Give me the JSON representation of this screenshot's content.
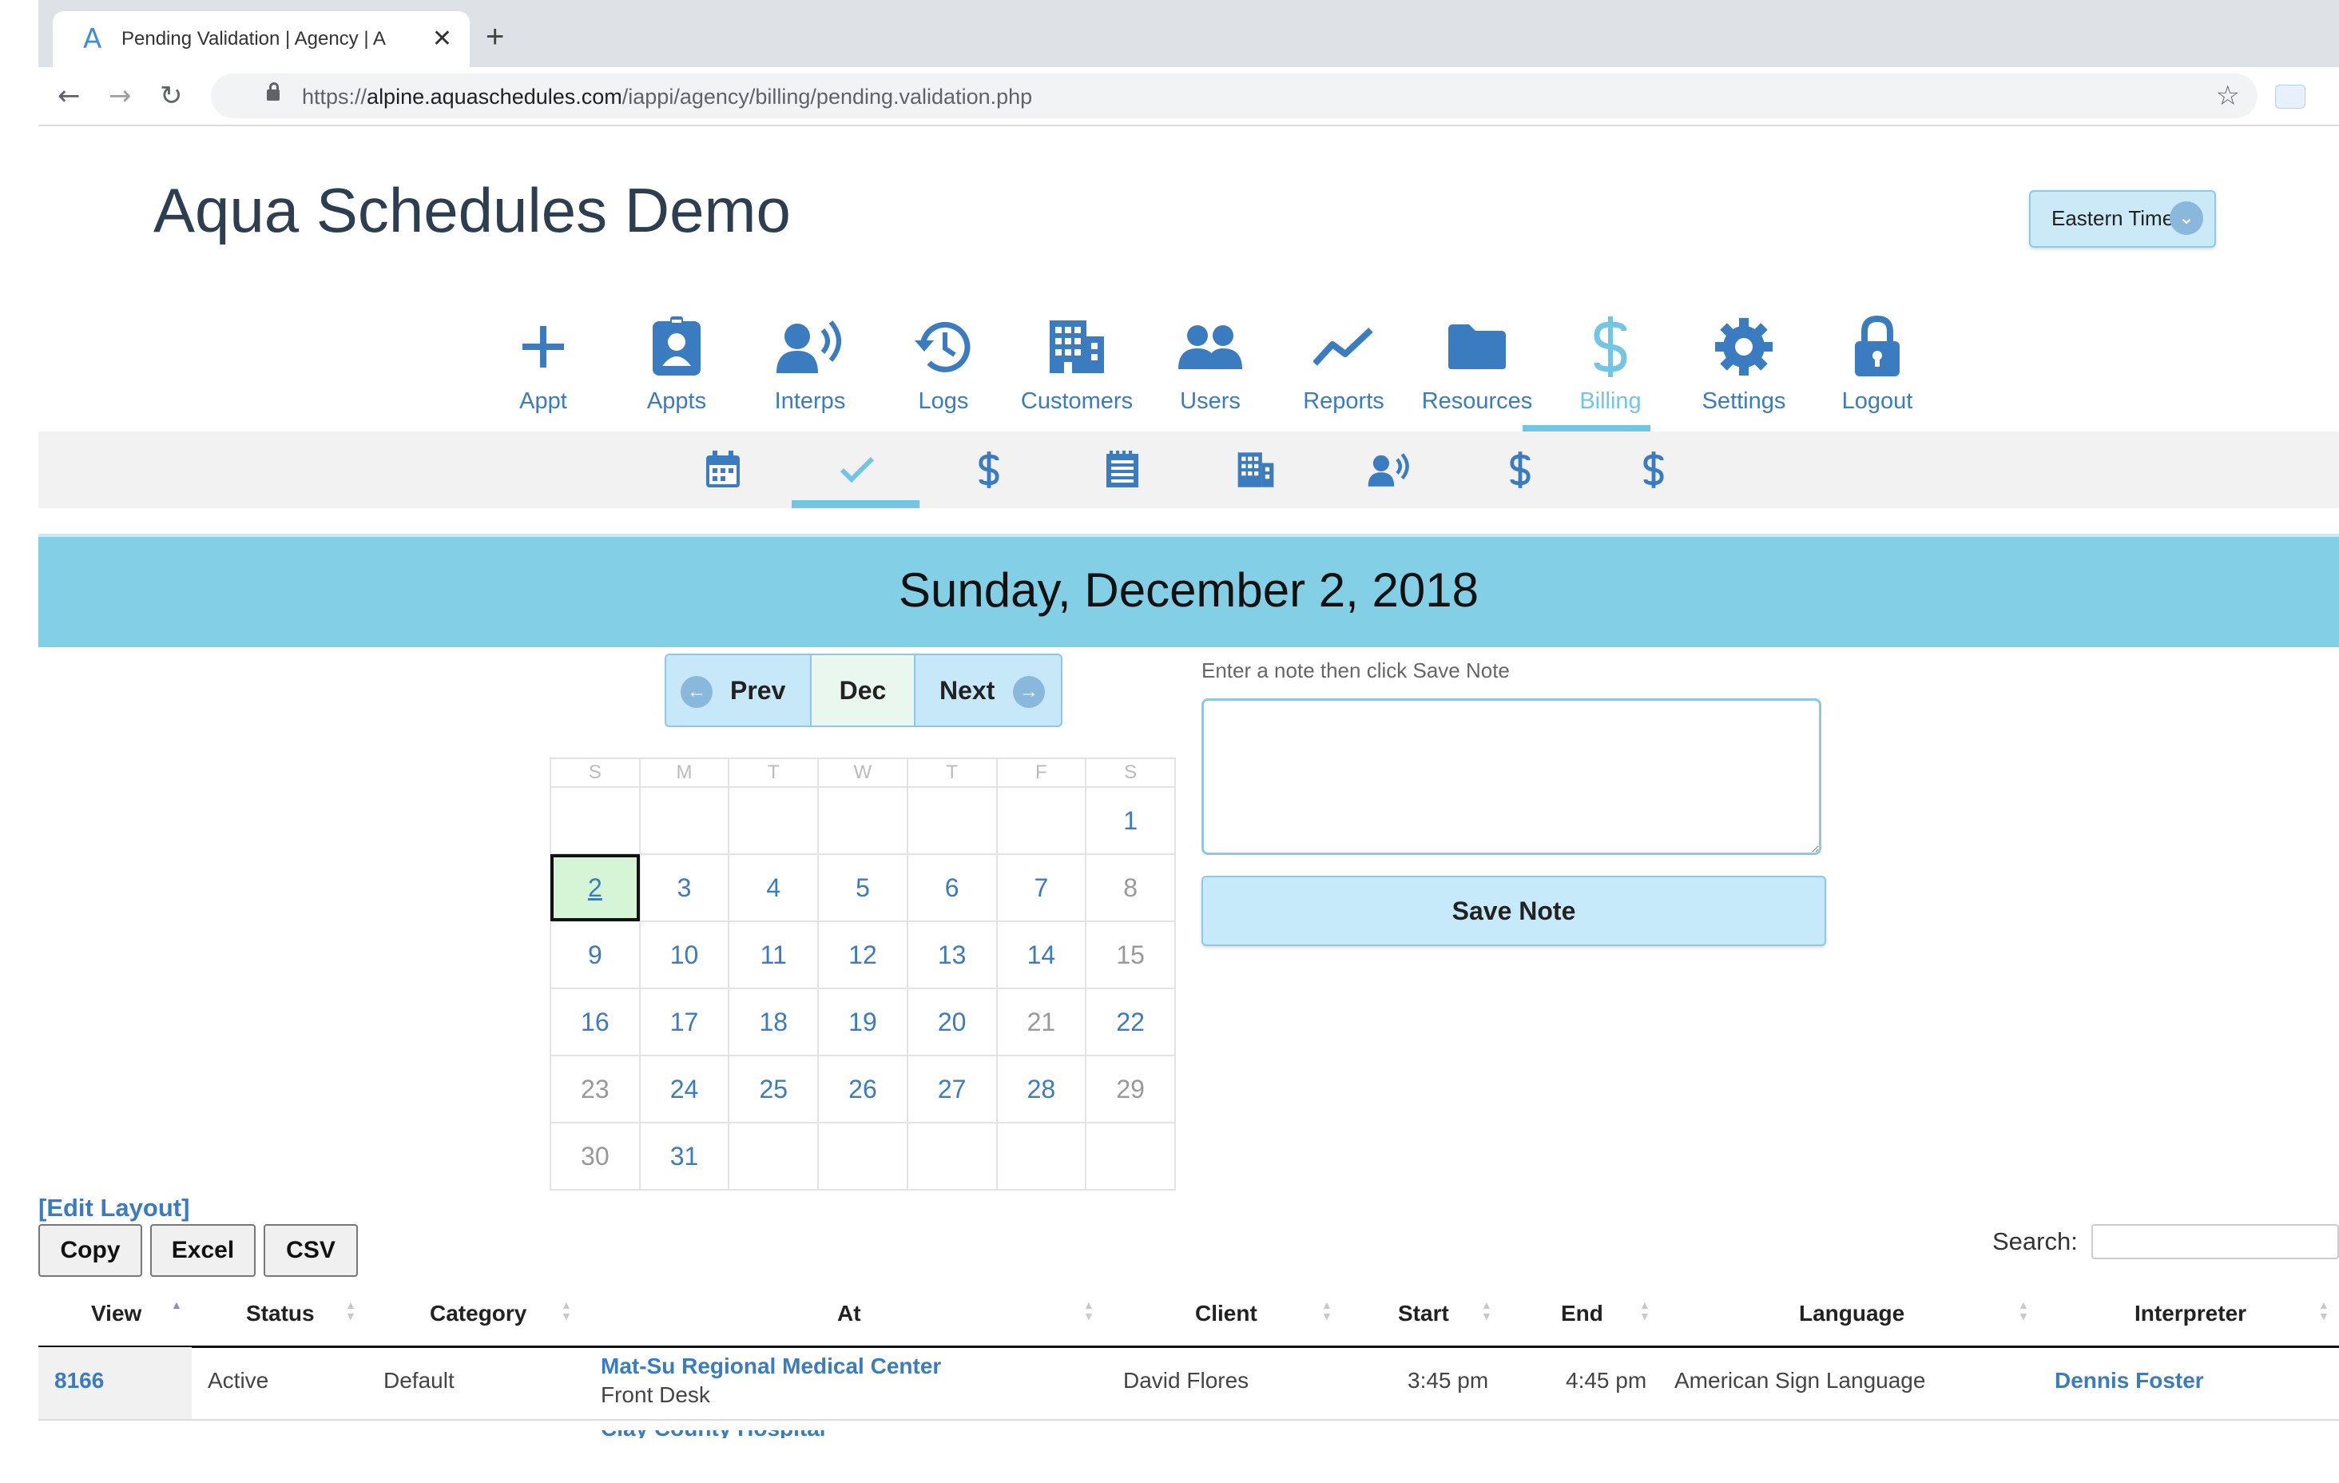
{
  "browser": {
    "tab_title": "Pending Validation | Agency | A",
    "url_scheme": "https://",
    "url_host": "alpine.aquaschedules.com",
    "url_path": "/iappi/agency/billing/pending.validation.php"
  },
  "header": {
    "site_title": "Aqua Schedules Demo",
    "timezone": "Eastern Time"
  },
  "nav": {
    "items": [
      {
        "label": "Appt",
        "icon": "plus-icon"
      },
      {
        "label": "Appts",
        "icon": "id-badge-icon"
      },
      {
        "label": "Interps",
        "icon": "interpreter-icon"
      },
      {
        "label": "Logs",
        "icon": "history-icon"
      },
      {
        "label": "Customers",
        "icon": "building-icon"
      },
      {
        "label": "Users",
        "icon": "users-icon"
      },
      {
        "label": "Reports",
        "icon": "chart-line-icon"
      },
      {
        "label": "Resources",
        "icon": "folder-icon"
      },
      {
        "label": "Billing",
        "icon": "dollar-icon"
      },
      {
        "label": "Settings",
        "icon": "gear-icon"
      },
      {
        "label": "Logout",
        "icon": "lock-icon"
      }
    ],
    "active": "Billing",
    "accent_color": "#73c5e4",
    "link_color": "#3b7bbf"
  },
  "subnav": {
    "icons": [
      "calendar-icon",
      "check-icon",
      "dollar-icon",
      "document-icon",
      "building-icon",
      "interpreter-icon",
      "dollar-icon",
      "dollar-icon"
    ],
    "active_index": 1
  },
  "banner": {
    "date": "Sunday, December 2, 2018",
    "color": "#83cfe5"
  },
  "pager": {
    "prev_label": "Prev",
    "month_label": "Dec",
    "next_label": "Next"
  },
  "calendar": {
    "weekdays": [
      "S",
      "M",
      "T",
      "W",
      "T",
      "F",
      "S"
    ],
    "weeks": [
      [
        "",
        "",
        "",
        "",
        "",
        "",
        "1"
      ],
      [
        "2",
        "3",
        "4",
        "5",
        "6",
        "7",
        "8"
      ],
      [
        "9",
        "10",
        "11",
        "12",
        "13",
        "14",
        "15"
      ],
      [
        "16",
        "17",
        "18",
        "19",
        "20",
        "21",
        "22"
      ],
      [
        "23",
        "24",
        "25",
        "26",
        "27",
        "28",
        "29"
      ],
      [
        "30",
        "31",
        "",
        "",
        "",
        "",
        ""
      ]
    ],
    "selected_day": "2",
    "inactive_days": [
      "8",
      "15",
      "21",
      "23",
      "29",
      "30"
    ]
  },
  "note": {
    "label": "Enter a note then click Save Note",
    "value": "",
    "save_label": "Save Note"
  },
  "table_controls": {
    "edit_layout_label": "[Edit Layout]",
    "copy_label": "Copy",
    "excel_label": "Excel",
    "csv_label": "CSV",
    "search_label": "Search:",
    "search_value": ""
  },
  "table": {
    "columns": [
      "View",
      "Status",
      "Category",
      "At",
      "Client",
      "Start",
      "End",
      "Language",
      "Interpreter"
    ],
    "rows": [
      {
        "view": "8166",
        "status": "Active",
        "category": "Default",
        "at": "Mat-Su Regional Medical Center",
        "at_sub": "Front Desk",
        "client": "David Flores",
        "start": "3:45 pm",
        "end": "4:45 pm",
        "language": "American Sign Language",
        "interpreter": "Dennis Foster"
      }
    ],
    "partial_next_row_at": "Clay County Hospital"
  }
}
